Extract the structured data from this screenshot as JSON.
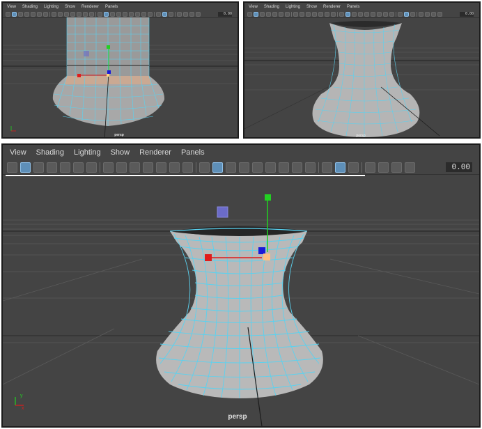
{
  "menu": [
    "View",
    "Shading",
    "Lighting",
    "Show",
    "Renderer",
    "Panels"
  ],
  "time_field": "0.00",
  "camera_label": "persp",
  "axis": {
    "y": "y",
    "x": "x"
  },
  "colors": {
    "viewport_bg": "#444444",
    "grid": "#5c5c5c",
    "wire": "#5ad2f0",
    "manip_x": "#e01b1b",
    "manip_y": "#22d022",
    "manip_z": "#1a1ad8",
    "pivot": "#ffc080",
    "scale_handle": "#6b6bc8"
  },
  "icons": [
    "camera-icon",
    "select-camera-icon",
    "lock-camera-icon",
    "bookmark-icon",
    "image-plane-icon",
    "2d-pan-icon",
    "grease-pencil-icon",
    "grid-icon",
    "film-gate-icon",
    "resolution-gate-icon",
    "gate-mask-icon",
    "field-chart-icon",
    "safe-action-icon",
    "safe-title-icon",
    "wireframe-icon",
    "smooth-shade-icon",
    "default-material-icon",
    "wireframe-on-shaded-icon",
    "textured-icon",
    "use-lights-icon",
    "shadows-icon",
    "ambient-occlusion-icon",
    "motion-blur-icon",
    "anti-aliasing-icon",
    "depth-of-field-icon",
    "isolate-select-icon",
    "xray-icon",
    "xray-joints-icon",
    "backface-icon",
    "exposure-icon"
  ]
}
